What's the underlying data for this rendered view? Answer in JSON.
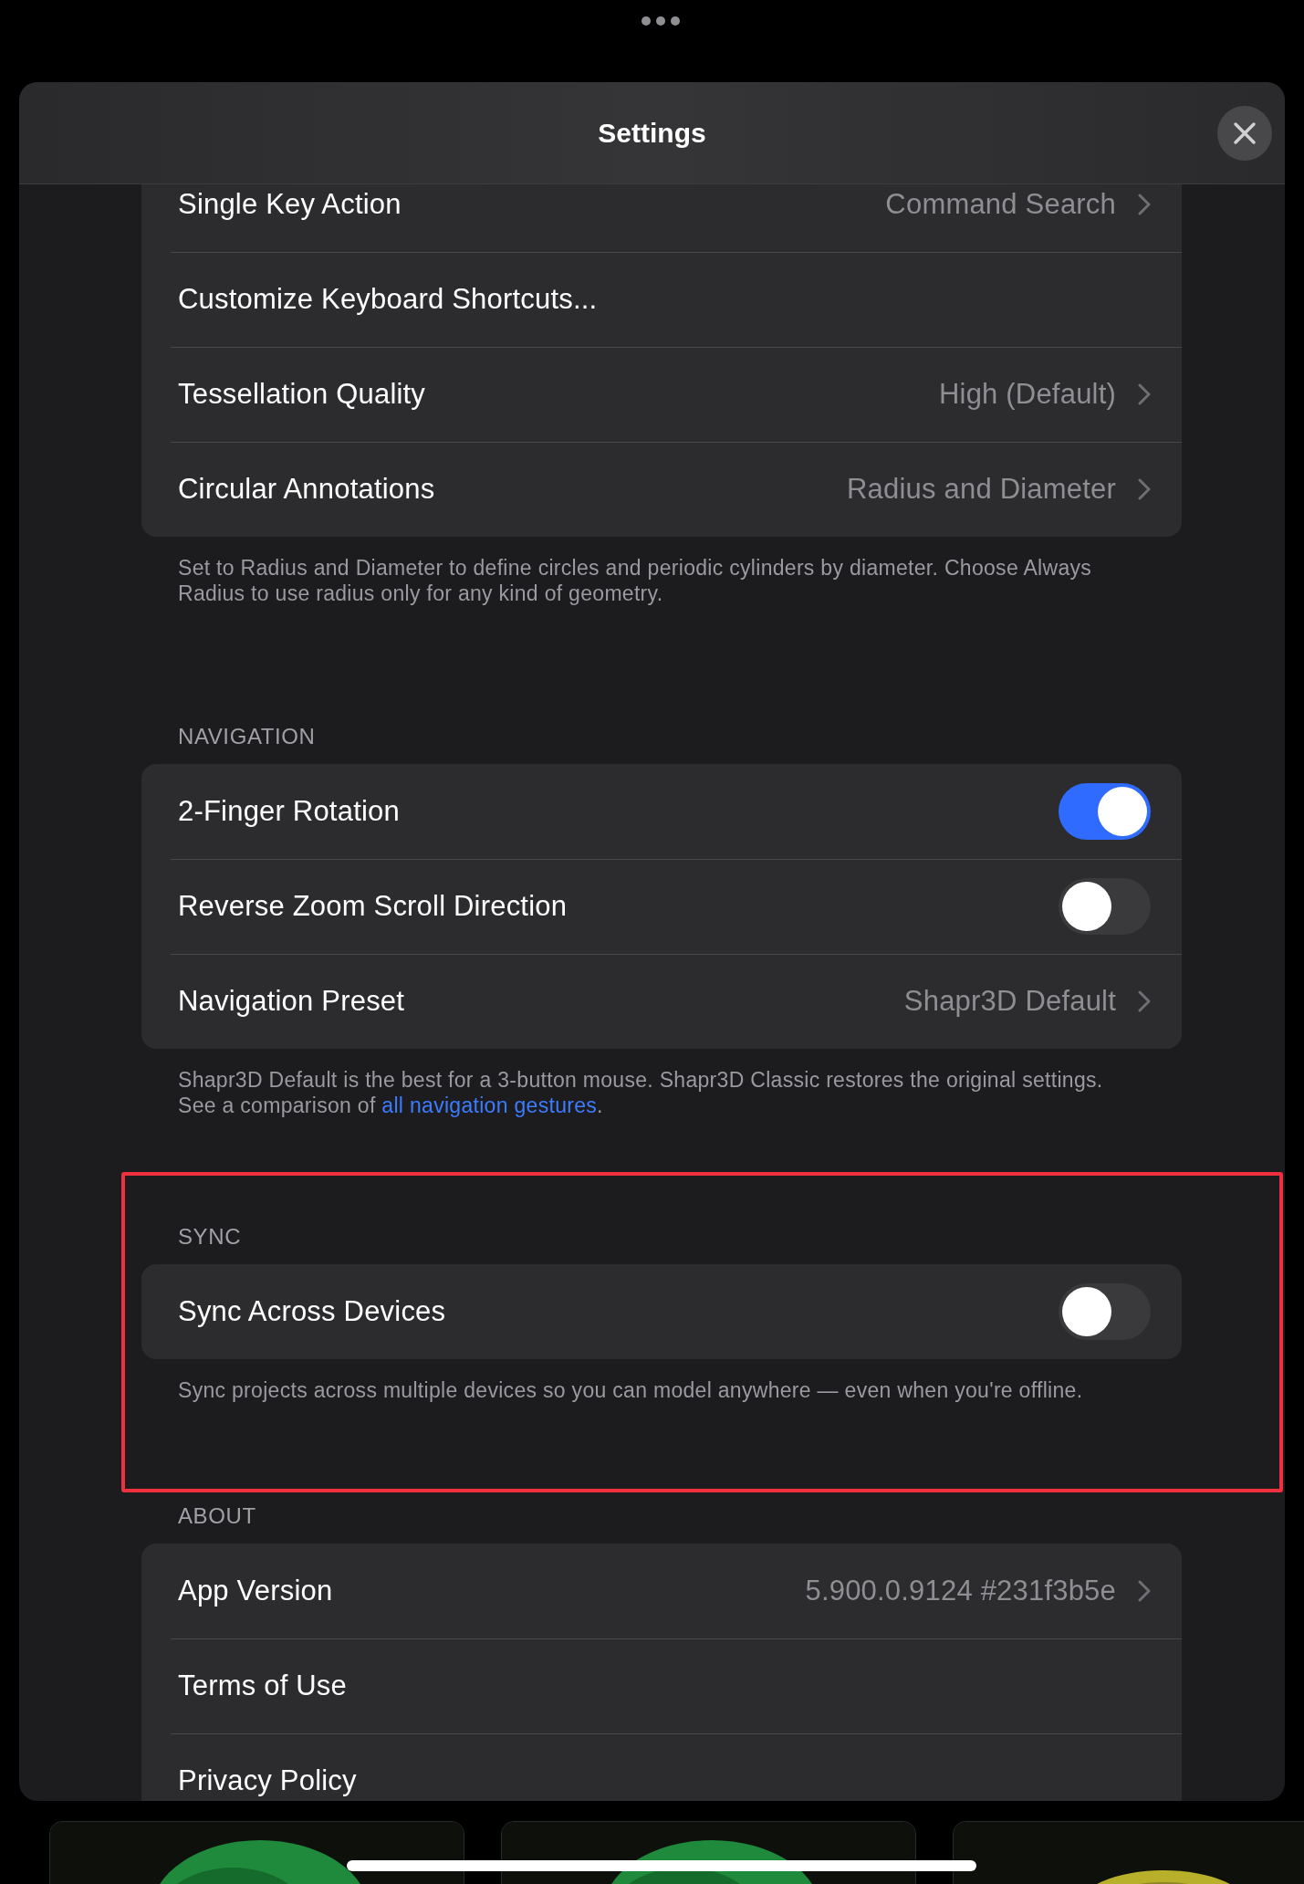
{
  "dialog": {
    "title": "Settings"
  },
  "sections": [
    {
      "highlighted": false,
      "rows": [
        {
          "kind": "disclosure",
          "label": "Single Key Action",
          "value": "Command Search"
        },
        {
          "kind": "action",
          "label": "Customize Keyboard Shortcuts..."
        },
        {
          "kind": "disclosure",
          "label": "Tessellation Quality",
          "value": "High (Default)"
        },
        {
          "kind": "disclosure",
          "label": "Circular Annotations",
          "value": "Radius and Diameter"
        }
      ],
      "footer": "Set to Radius and Diameter to define circles and periodic cylinders by diameter. Choose Always Radius to use radius only for any kind of geometry."
    },
    {
      "header": "NAVIGATION",
      "highlighted": false,
      "rows": [
        {
          "kind": "toggle",
          "label": "2-Finger Rotation",
          "on": true
        },
        {
          "kind": "toggle",
          "label": "Reverse Zoom Scroll Direction",
          "on": false
        },
        {
          "kind": "disclosure",
          "label": "Navigation Preset",
          "value": "Shapr3D Default"
        }
      ],
      "footer": "Shapr3D Default is the best for a 3-button mouse. Shapr3D Classic restores the original settings. See a comparison of ",
      "footer_link": "all navigation gestures",
      "footer_end": "."
    },
    {
      "header": "SYNC",
      "highlighted": true,
      "rows": [
        {
          "kind": "toggle",
          "label": "Sync Across Devices",
          "on": false
        }
      ],
      "footer": "Sync projects across multiple devices so you can model anywhere — even when you're offline."
    },
    {
      "header": "ABOUT",
      "highlighted": false,
      "rows": [
        {
          "kind": "disclosure",
          "label": "App Version",
          "value": "5.900.0.9124 #231f3b5e"
        },
        {
          "kind": "action",
          "label": "Terms of Use"
        },
        {
          "kind": "action",
          "label": "Privacy Policy"
        }
      ]
    }
  ]
}
